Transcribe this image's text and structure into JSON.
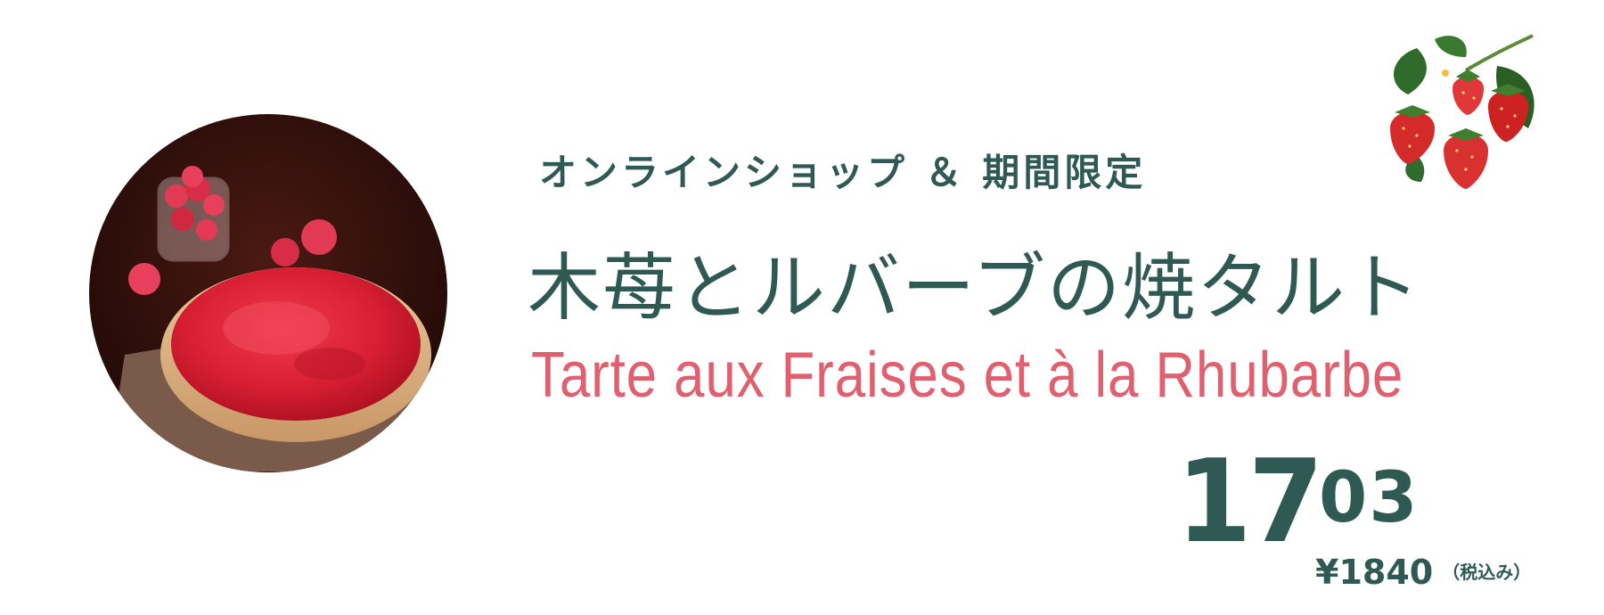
{
  "banner": {
    "tagline": "オンラインショップ ＆ 期間限定",
    "title_ja": "木苺とルバーブの焼タルト",
    "title_fr": "Tarte aux Fraises et à la Rhubarbe"
  },
  "price": {
    "integer": "17",
    "decimal": "03",
    "incl_tax_amount": "¥1840",
    "incl_tax_note": "（税込み）"
  },
  "colors": {
    "title_green": "#2f5a54",
    "accent_pink": "#e0606f",
    "background": "#ffffff"
  },
  "images": {
    "product_photo": "raspberry-rhubarb-tart-photo",
    "decoration": "strawberry-branch-illustration"
  }
}
